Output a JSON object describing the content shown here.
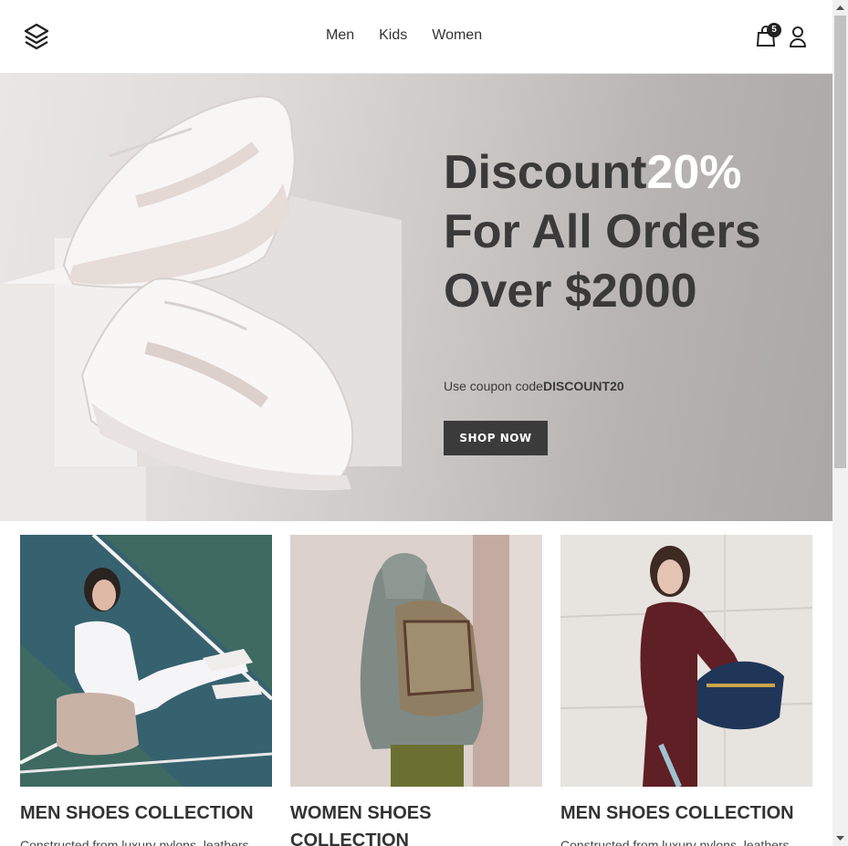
{
  "header": {
    "nav": [
      "Men",
      "Kids",
      "Women"
    ],
    "cart_count": "5",
    "icons": {
      "logo": "layers-logo",
      "cart": "shopping-bag-icon",
      "user": "user-icon"
    }
  },
  "hero": {
    "title_part1": "Discount",
    "title_highlight": "20%",
    "title_part2": "For All Orders Over $2000",
    "coupon_prefix": "Use coupon code",
    "coupon_code": "DISCOUNT20",
    "button_label": "SHOP NOW",
    "highlight_color": "#ffffff",
    "button_color": "#3b3b3b"
  },
  "collections": [
    {
      "title": "MEN SHOES COLLECTION",
      "desc": "Constructed from luxury nylons, leathers,"
    },
    {
      "title": "WOMEN SHOES COLLECTION",
      "desc": ""
    },
    {
      "title": "MEN SHOES COLLECTION",
      "desc": "Constructed from luxury nylons, leathers,"
    }
  ]
}
